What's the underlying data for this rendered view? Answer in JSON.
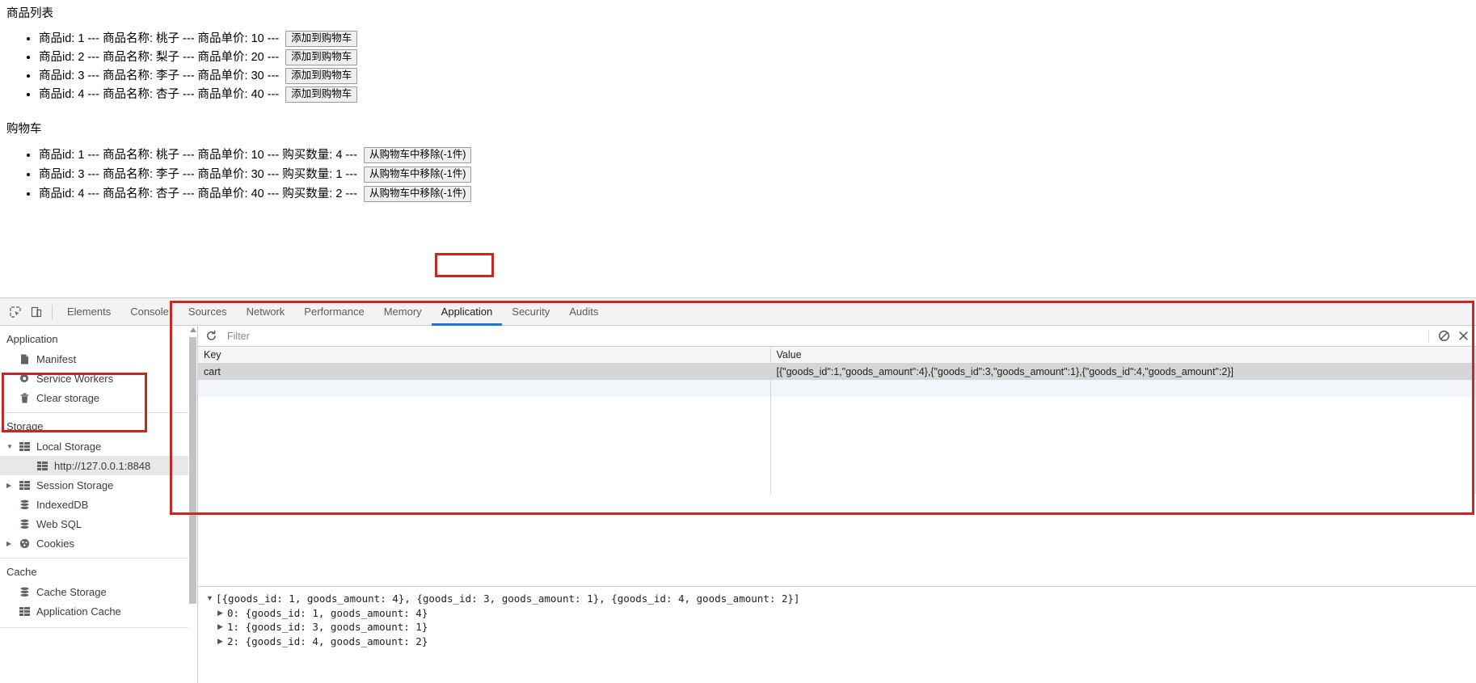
{
  "page": {
    "goods_heading": "商品列表",
    "cart_heading": "购物车",
    "goods_list": [
      {
        "line": "商品id: 1 --- 商品名称: 桃子 --- 商品单价: 10 ---",
        "button": "添加到购物车"
      },
      {
        "line": "商品id: 2 --- 商品名称: 梨子 --- 商品单价: 20 ---",
        "button": "添加到购物车"
      },
      {
        "line": "商品id: 3 --- 商品名称: 李子 --- 商品单价: 30 ---",
        "button": "添加到购物车"
      },
      {
        "line": "商品id: 4 --- 商品名称: 杏子 --- 商品单价: 40 ---",
        "button": "添加到购物车"
      }
    ],
    "cart_list": [
      {
        "line": "商品id: 1 --- 商品名称: 桃子 --- 商品单价: 10 --- 购买数量: 4 ---",
        "button": "从购物车中移除(-1件)"
      },
      {
        "line": "商品id: 3 --- 商品名称: 李子 --- 商品单价: 30 --- 购买数量: 1 ---",
        "button": "从购物车中移除(-1件)"
      },
      {
        "line": "商品id: 4 --- 商品名称: 杏子 --- 商品单价: 40 --- 购买数量: 2 ---",
        "button": "从购物车中移除(-1件)"
      }
    ]
  },
  "devtools": {
    "tabs": [
      {
        "label": "Elements",
        "active": false
      },
      {
        "label": "Console",
        "active": false
      },
      {
        "label": "Sources",
        "active": false
      },
      {
        "label": "Network",
        "active": false
      },
      {
        "label": "Performance",
        "active": false
      },
      {
        "label": "Memory",
        "active": false
      },
      {
        "label": "Application",
        "active": true
      },
      {
        "label": "Security",
        "active": false
      },
      {
        "label": "Audits",
        "active": false
      }
    ],
    "sidebar": {
      "application_title": "Application",
      "application_items": [
        {
          "label": "Manifest",
          "icon": "document-icon"
        },
        {
          "label": "Service Workers",
          "icon": "gear-icon"
        },
        {
          "label": "Clear storage",
          "icon": "trash-icon"
        }
      ],
      "storage_title": "Storage",
      "storage_items": [
        {
          "label": "Local Storage",
          "icon": "grid-icon",
          "twisty": "▼",
          "selected": false,
          "indent": 1
        },
        {
          "label": "http://127.0.0.1:8848",
          "icon": "grid-icon",
          "twisty": "",
          "selected": true,
          "indent": 2
        },
        {
          "label": "Session Storage",
          "icon": "grid-icon",
          "twisty": "▶",
          "selected": false,
          "indent": 1
        },
        {
          "label": "IndexedDB",
          "icon": "database-icon",
          "twisty": "",
          "selected": false,
          "indent": 1
        },
        {
          "label": "Web SQL",
          "icon": "database-icon",
          "twisty": "",
          "selected": false,
          "indent": 1
        },
        {
          "label": "Cookies",
          "icon": "cookie-icon",
          "twisty": "▶",
          "selected": false,
          "indent": 1
        }
      ],
      "cache_title": "Cache",
      "cache_items": [
        {
          "label": "Cache Storage",
          "icon": "database-icon"
        },
        {
          "label": "Application Cache",
          "icon": "grid-icon"
        }
      ]
    },
    "toolbar": {
      "refresh_icon": "refresh-icon",
      "filter_placeholder": "Filter",
      "filter_value": "",
      "clear_icon": "no-entry-icon",
      "delete_icon": "close-icon"
    },
    "table": {
      "columns": [
        "Key",
        "Value"
      ],
      "rows": [
        {
          "key": "cart",
          "value": "[{\"goods_id\":1,\"goods_amount\":4},{\"goods_id\":3,\"goods_amount\":1},{\"goods_id\":4,\"goods_amount\":2}]"
        }
      ]
    },
    "preview": {
      "root": "[{goods_id: 1, goods_amount: 4}, {goods_id: 3, goods_amount: 1}, {goods_id: 4, goods_amount: 2}]",
      "root_twisty": "▼",
      "children": [
        {
          "twisty": "▶",
          "text": "0: {goods_id: 1, goods_amount: 4}"
        },
        {
          "twisty": "▶",
          "text": "1: {goods_id: 3, goods_amount: 1}"
        },
        {
          "twisty": "▶",
          "text": "2: {goods_id: 4, goods_amount: 2}"
        }
      ]
    },
    "highlight_color": "#c62828"
  }
}
